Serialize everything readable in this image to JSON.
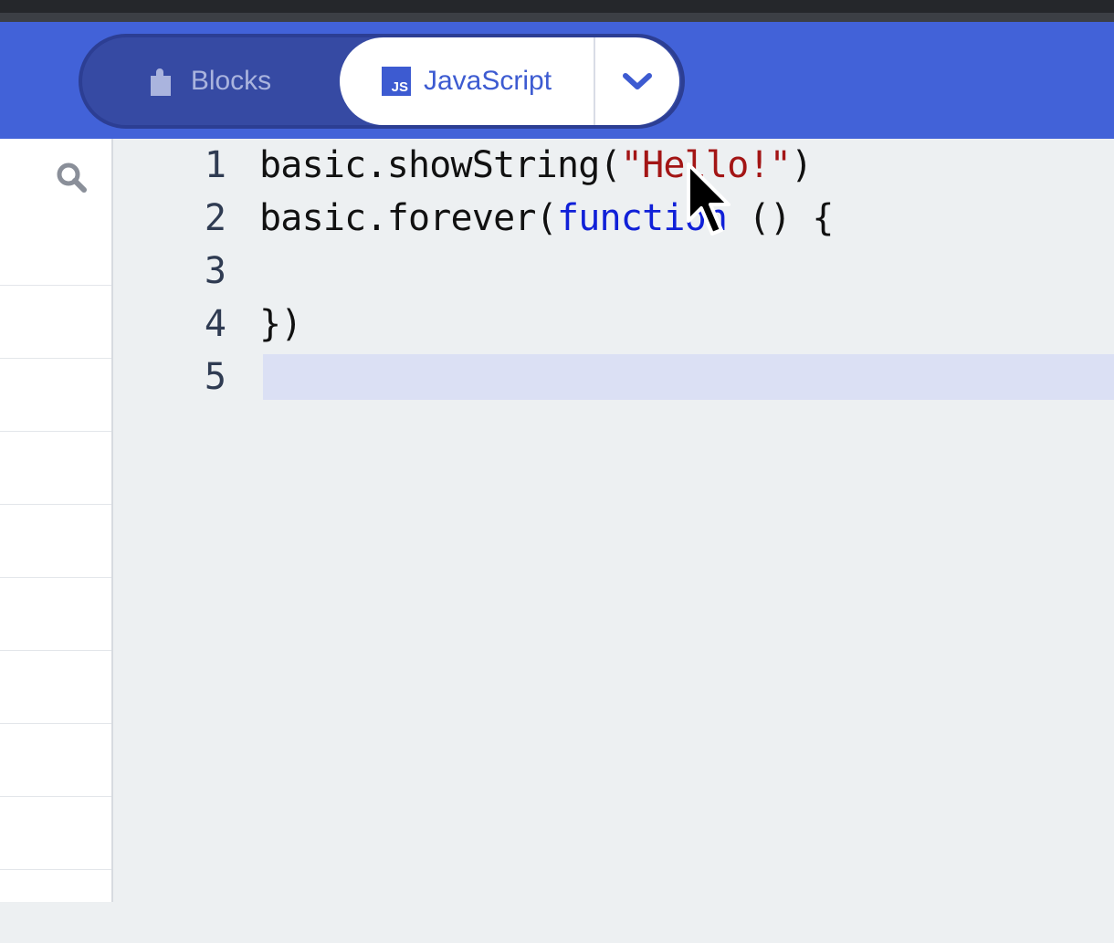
{
  "header": {
    "tab_blocks_label": "Blocks",
    "tab_js_label": "JavaScript",
    "js_badge": "JS",
    "active_tab": "JavaScript"
  },
  "colors": {
    "header_bg": "#4262d8",
    "keyword": "#1020d8",
    "string": "#a31515",
    "current_line": "#dbe0f4"
  },
  "icons": {
    "blocks": "puzzle-icon",
    "javascript": "js-icon",
    "dropdown": "chevron-down-icon",
    "search": "search-icon"
  },
  "editor": {
    "lines": [
      {
        "num": "1",
        "parts": [
          {
            "t": "basic.showString(",
            "c": "plain"
          },
          {
            "t": "\"Hello!\"",
            "c": "str"
          },
          {
            "t": ")",
            "c": "plain"
          }
        ]
      },
      {
        "num": "2",
        "parts": [
          {
            "t": "basic.forever(",
            "c": "plain"
          },
          {
            "t": "function",
            "c": "kw"
          },
          {
            "t": " () {",
            "c": "plain"
          }
        ]
      },
      {
        "num": "3",
        "parts": []
      },
      {
        "num": "4",
        "parts": [
          {
            "t": "})",
            "c": "plain"
          }
        ]
      },
      {
        "num": "5",
        "parts": []
      }
    ],
    "current_line": 5
  }
}
